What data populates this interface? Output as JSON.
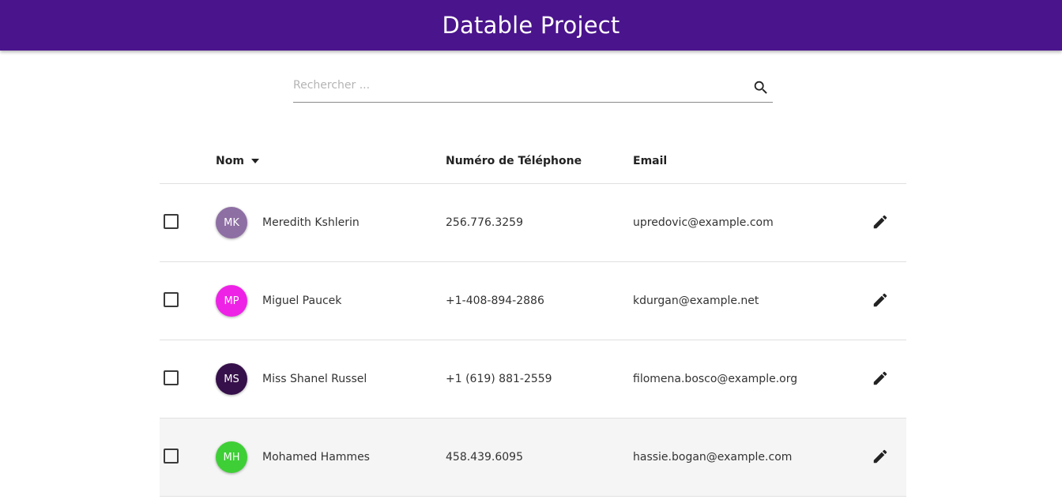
{
  "app": {
    "title": "Datable Project"
  },
  "search": {
    "placeholder": "Rechercher ...",
    "value": ""
  },
  "table": {
    "columns": {
      "name": "Nom",
      "phone": "Numéro de Téléphone",
      "email": "Email"
    },
    "rows": [
      {
        "initials": "MK",
        "avatar_color": "#8e6fa3",
        "name": "Meredith Kshlerin",
        "phone": "256.776.3259",
        "email": "upredovic@example.com"
      },
      {
        "initials": "MP",
        "avatar_color": "#ee22e6",
        "name": "Miguel Paucek",
        "phone": "+1-408-894-2886",
        "email": "kdurgan@example.net"
      },
      {
        "initials": "MS",
        "avatar_color": "#36104a",
        "name": "Miss Shanel Russel",
        "phone": "+1 (619) 881-2559",
        "email": "filomena.bosco@example.org"
      },
      {
        "initials": "MH",
        "avatar_color": "#3ecf36",
        "name": "Mohamed Hammes",
        "phone": "458.439.6095",
        "email": "hassie.bogan@example.com"
      }
    ]
  },
  "colors": {
    "app_bar": "#4a148c",
    "row_hover": "#f5f5f5"
  },
  "icons": {
    "search": "search-icon",
    "sort": "sort-down-icon",
    "edit": "pencil-icon"
  }
}
